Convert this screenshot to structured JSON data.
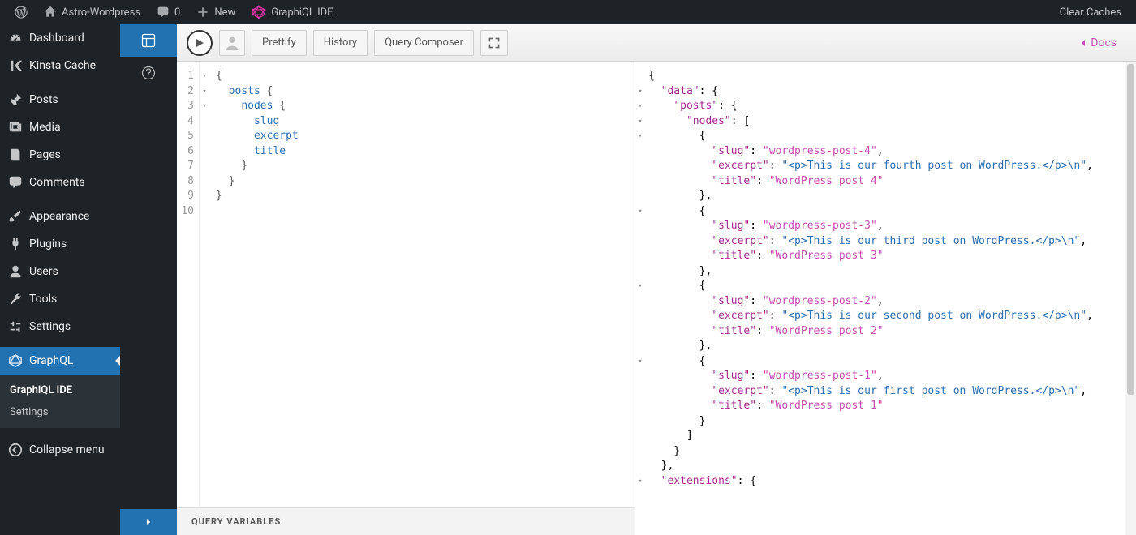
{
  "adminbar": {
    "site": "Astro-Wordpress",
    "comments_count": "0",
    "new": "New",
    "graphiql": "GraphiQL IDE",
    "clear_caches": "Clear Caches"
  },
  "sidebar": {
    "items": {
      "dashboard": "Dashboard",
      "kinsta": "Kinsta Cache",
      "posts": "Posts",
      "media": "Media",
      "pages": "Pages",
      "comments": "Comments",
      "appearance": "Appearance",
      "plugins": "Plugins",
      "users": "Users",
      "tools": "Tools",
      "settings": "Settings",
      "graphql": "GraphQL",
      "collapse": "Collapse menu"
    },
    "sub": {
      "ide": "GraphiQL IDE",
      "settings": "Settings"
    }
  },
  "toolbar": {
    "prettify": "Prettify",
    "history": "History",
    "composer": "Query Composer",
    "docs": "Docs"
  },
  "query": {
    "lines": [
      "1",
      "2",
      "3",
      "4",
      "5",
      "6",
      "7",
      "8",
      "9",
      "10"
    ],
    "fold": [
      "▾",
      "▾",
      "▾",
      "",
      "",
      "",
      "",
      "",
      "",
      ""
    ],
    "body": "{\n  posts {\n    nodes {\n      slug\n      excerpt\n      title\n    }\n  }\n}"
  },
  "qv_label": "QUERY VARIABLES",
  "result": {
    "data_key": "\"data\"",
    "posts_key": "\"posts\"",
    "nodes_key": "\"nodes\"",
    "slug_key": "\"slug\"",
    "excerpt_key": "\"excerpt\"",
    "title_key": "\"title\"",
    "extensions_key": "\"extensions\"",
    "nodes": [
      {
        "slug": "\"wordpress-post-4\"",
        "excerpt": "\"<p>This is our fourth post on WordPress.</p>\\n\"",
        "title": "\"WordPress post 4\""
      },
      {
        "slug": "\"wordpress-post-3\"",
        "excerpt": "\"<p>This is our third post on WordPress.</p>\\n\"",
        "title": "\"WordPress post 3\""
      },
      {
        "slug": "\"wordpress-post-2\"",
        "excerpt": "\"<p>This is our second post on WordPress.</p>\\n\"",
        "title": "\"WordPress post 2\""
      },
      {
        "slug": "\"wordpress-post-1\"",
        "excerpt": "\"<p>This is our first post on WordPress.</p>\\n\"",
        "title": "\"WordPress post 1\""
      }
    ]
  }
}
